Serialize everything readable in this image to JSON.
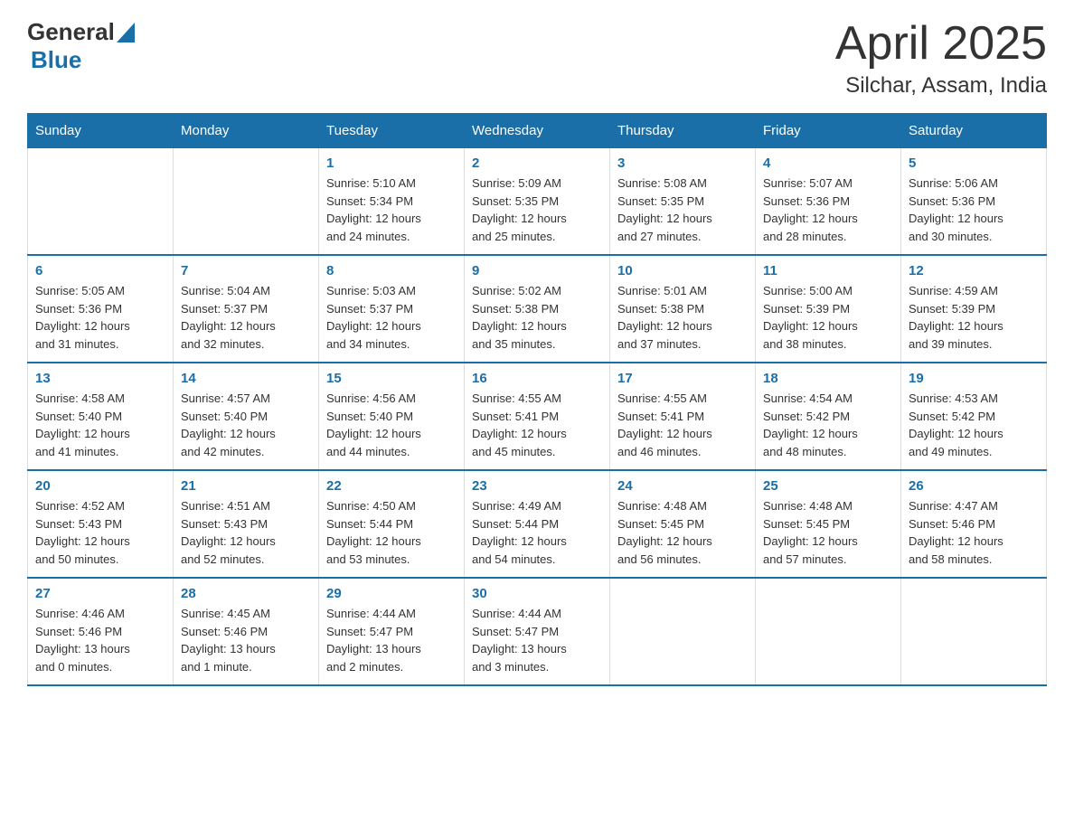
{
  "header": {
    "logo_general": "General",
    "logo_blue": "Blue",
    "title": "April 2025",
    "subtitle": "Silchar, Assam, India"
  },
  "weekdays": [
    "Sunday",
    "Monday",
    "Tuesday",
    "Wednesday",
    "Thursday",
    "Friday",
    "Saturday"
  ],
  "weeks": [
    [
      {
        "day": "",
        "info": ""
      },
      {
        "day": "",
        "info": ""
      },
      {
        "day": "1",
        "info": "Sunrise: 5:10 AM\nSunset: 5:34 PM\nDaylight: 12 hours\nand 24 minutes."
      },
      {
        "day": "2",
        "info": "Sunrise: 5:09 AM\nSunset: 5:35 PM\nDaylight: 12 hours\nand 25 minutes."
      },
      {
        "day": "3",
        "info": "Sunrise: 5:08 AM\nSunset: 5:35 PM\nDaylight: 12 hours\nand 27 minutes."
      },
      {
        "day": "4",
        "info": "Sunrise: 5:07 AM\nSunset: 5:36 PM\nDaylight: 12 hours\nand 28 minutes."
      },
      {
        "day": "5",
        "info": "Sunrise: 5:06 AM\nSunset: 5:36 PM\nDaylight: 12 hours\nand 30 minutes."
      }
    ],
    [
      {
        "day": "6",
        "info": "Sunrise: 5:05 AM\nSunset: 5:36 PM\nDaylight: 12 hours\nand 31 minutes."
      },
      {
        "day": "7",
        "info": "Sunrise: 5:04 AM\nSunset: 5:37 PM\nDaylight: 12 hours\nand 32 minutes."
      },
      {
        "day": "8",
        "info": "Sunrise: 5:03 AM\nSunset: 5:37 PM\nDaylight: 12 hours\nand 34 minutes."
      },
      {
        "day": "9",
        "info": "Sunrise: 5:02 AM\nSunset: 5:38 PM\nDaylight: 12 hours\nand 35 minutes."
      },
      {
        "day": "10",
        "info": "Sunrise: 5:01 AM\nSunset: 5:38 PM\nDaylight: 12 hours\nand 37 minutes."
      },
      {
        "day": "11",
        "info": "Sunrise: 5:00 AM\nSunset: 5:39 PM\nDaylight: 12 hours\nand 38 minutes."
      },
      {
        "day": "12",
        "info": "Sunrise: 4:59 AM\nSunset: 5:39 PM\nDaylight: 12 hours\nand 39 minutes."
      }
    ],
    [
      {
        "day": "13",
        "info": "Sunrise: 4:58 AM\nSunset: 5:40 PM\nDaylight: 12 hours\nand 41 minutes."
      },
      {
        "day": "14",
        "info": "Sunrise: 4:57 AM\nSunset: 5:40 PM\nDaylight: 12 hours\nand 42 minutes."
      },
      {
        "day": "15",
        "info": "Sunrise: 4:56 AM\nSunset: 5:40 PM\nDaylight: 12 hours\nand 44 minutes."
      },
      {
        "day": "16",
        "info": "Sunrise: 4:55 AM\nSunset: 5:41 PM\nDaylight: 12 hours\nand 45 minutes."
      },
      {
        "day": "17",
        "info": "Sunrise: 4:55 AM\nSunset: 5:41 PM\nDaylight: 12 hours\nand 46 minutes."
      },
      {
        "day": "18",
        "info": "Sunrise: 4:54 AM\nSunset: 5:42 PM\nDaylight: 12 hours\nand 48 minutes."
      },
      {
        "day": "19",
        "info": "Sunrise: 4:53 AM\nSunset: 5:42 PM\nDaylight: 12 hours\nand 49 minutes."
      }
    ],
    [
      {
        "day": "20",
        "info": "Sunrise: 4:52 AM\nSunset: 5:43 PM\nDaylight: 12 hours\nand 50 minutes."
      },
      {
        "day": "21",
        "info": "Sunrise: 4:51 AM\nSunset: 5:43 PM\nDaylight: 12 hours\nand 52 minutes."
      },
      {
        "day": "22",
        "info": "Sunrise: 4:50 AM\nSunset: 5:44 PM\nDaylight: 12 hours\nand 53 minutes."
      },
      {
        "day": "23",
        "info": "Sunrise: 4:49 AM\nSunset: 5:44 PM\nDaylight: 12 hours\nand 54 minutes."
      },
      {
        "day": "24",
        "info": "Sunrise: 4:48 AM\nSunset: 5:45 PM\nDaylight: 12 hours\nand 56 minutes."
      },
      {
        "day": "25",
        "info": "Sunrise: 4:48 AM\nSunset: 5:45 PM\nDaylight: 12 hours\nand 57 minutes."
      },
      {
        "day": "26",
        "info": "Sunrise: 4:47 AM\nSunset: 5:46 PM\nDaylight: 12 hours\nand 58 minutes."
      }
    ],
    [
      {
        "day": "27",
        "info": "Sunrise: 4:46 AM\nSunset: 5:46 PM\nDaylight: 13 hours\nand 0 minutes."
      },
      {
        "day": "28",
        "info": "Sunrise: 4:45 AM\nSunset: 5:46 PM\nDaylight: 13 hours\nand 1 minute."
      },
      {
        "day": "29",
        "info": "Sunrise: 4:44 AM\nSunset: 5:47 PM\nDaylight: 13 hours\nand 2 minutes."
      },
      {
        "day": "30",
        "info": "Sunrise: 4:44 AM\nSunset: 5:47 PM\nDaylight: 13 hours\nand 3 minutes."
      },
      {
        "day": "",
        "info": ""
      },
      {
        "day": "",
        "info": ""
      },
      {
        "day": "",
        "info": ""
      }
    ]
  ]
}
